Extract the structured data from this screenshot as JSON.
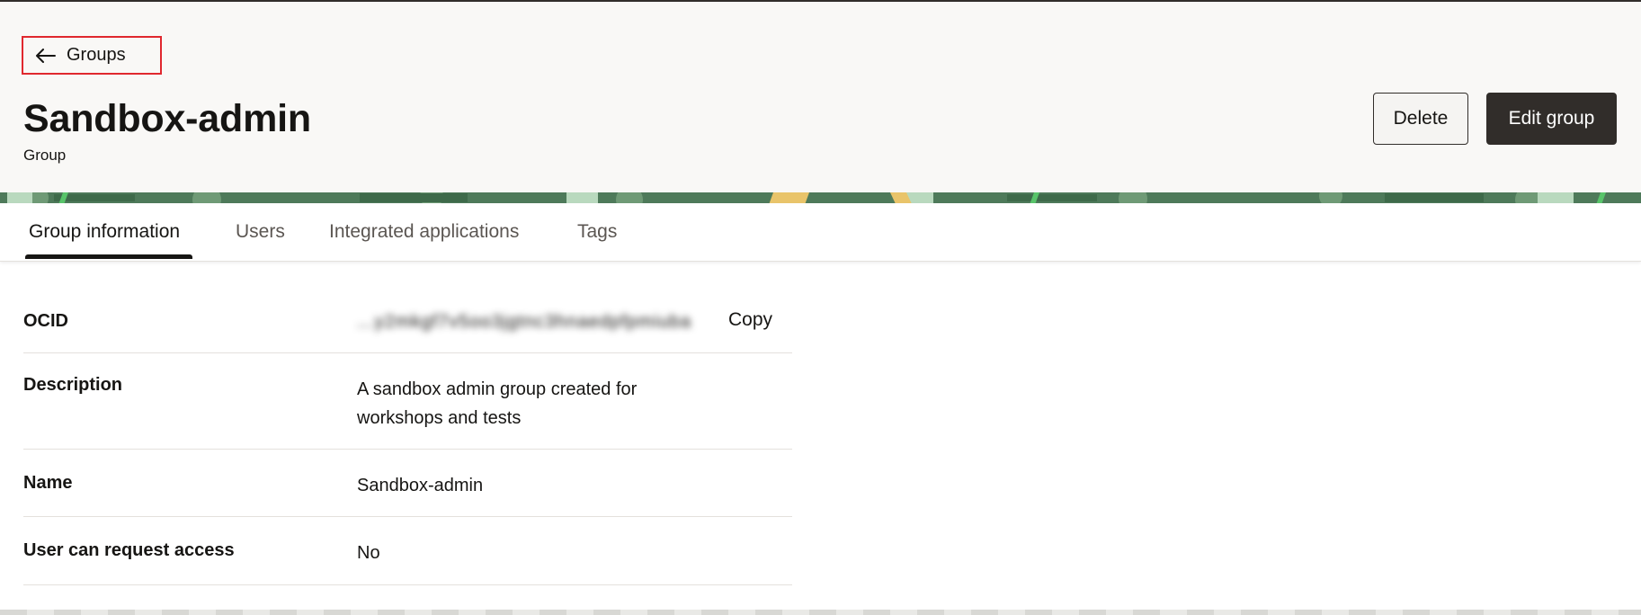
{
  "header": {
    "back_link_label": "Groups",
    "title": "Sandbox-admin",
    "subtitle": "Group",
    "delete_label": "Delete",
    "edit_label": "Edit group"
  },
  "tabs": [
    {
      "label": "Group information",
      "active": true
    },
    {
      "label": "Users",
      "active": false
    },
    {
      "label": "Integrated applications",
      "active": false
    },
    {
      "label": "Tags",
      "active": false
    }
  ],
  "details": {
    "ocid": {
      "label": "OCID",
      "value": "...y2mkgf7v5oo3jgtnc3hnaedpfpmiuba",
      "copy_label": "Copy"
    },
    "description": {
      "label": "Description",
      "line1": "A sandbox admin group created for",
      "line2": "workshops and tests"
    },
    "name": {
      "label": "Name",
      "value": "Sandbox-admin"
    },
    "access": {
      "label": "User can request access",
      "value": "No"
    }
  },
  "colors": {
    "primary_button": "#312d2a",
    "header_bg": "#f9f8f6",
    "highlight_border": "#e0282e",
    "banner_green": "#4e7a5a"
  },
  "icons": {
    "back": "arrow-left-icon"
  }
}
